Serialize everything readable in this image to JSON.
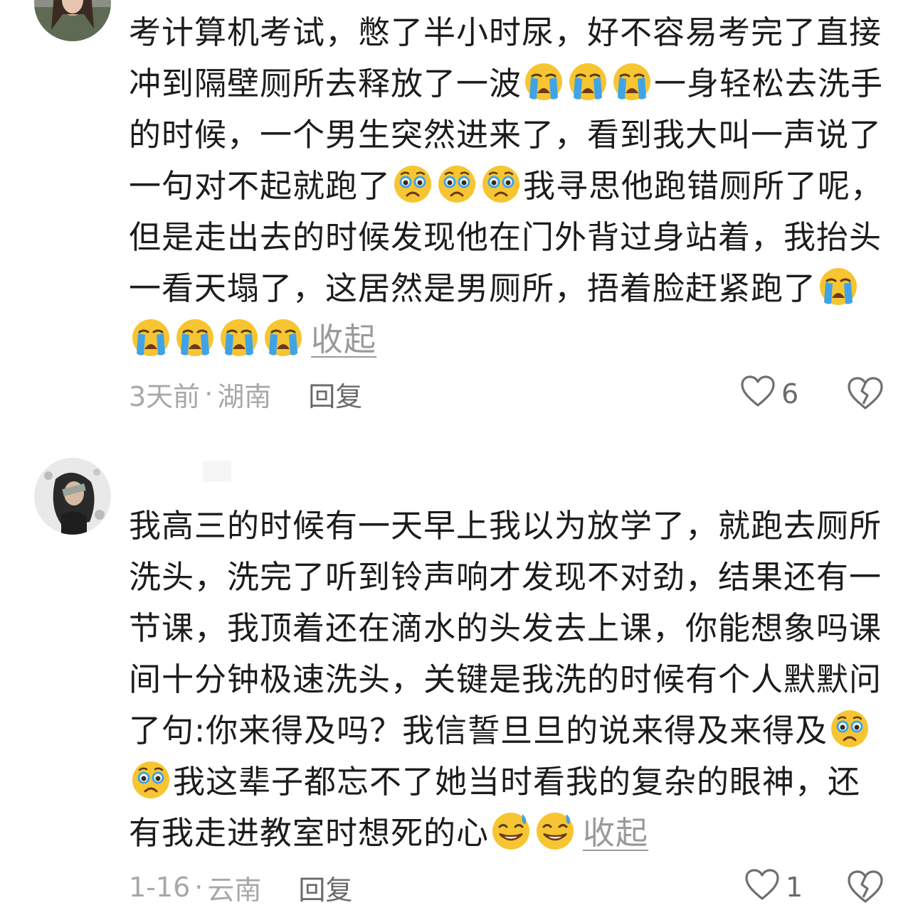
{
  "comments": [
    {
      "avatar_icon": "user-avatar-photo",
      "segments": [
        {
          "t": "考计算机考试，憋了半小时尿，好不容易考完了直接冲到隔壁厕所去释放了一波"
        },
        {
          "emoji": "loudly-crying-face"
        },
        {
          "emoji": "loudly-crying-face"
        },
        {
          "emoji": "loudly-crying-face"
        },
        {
          "t": "一身轻松去洗手的时候，一个男生突然进来了，看到我大叫一声说了一句对不起就跑了"
        },
        {
          "emoji": "face-holding-back-tears"
        },
        {
          "emoji": "face-holding-back-tears"
        },
        {
          "emoji": "face-holding-back-tears"
        },
        {
          "t": "我寻思他跑错厕所了呢，但是走出去的时候发现他在门外背过身站着，我抬头一看天塌了，这居然是男厕所，捂着脸赶紧跑了"
        },
        {
          "emoji": "loudly-crying-face"
        },
        {
          "emoji": "loudly-crying-face"
        },
        {
          "emoji": "loudly-crying-face"
        },
        {
          "emoji": "loudly-crying-face"
        },
        {
          "emoji": "loudly-crying-face"
        }
      ],
      "collapse_label": "收起",
      "time": "3天前",
      "separator": "·",
      "location": "湖南",
      "reply_label": "回复",
      "like_count": "6"
    },
    {
      "avatar_icon": "user-avatar-photo",
      "segments": [
        {
          "t": "我高三的时候有一天早上我以为放学了，就跑去厕所洗头，洗完了听到铃声响才发现不对劲，结果还有一节课，我顶着还在滴水的头发去上课，你能想象吗课间十分钟极速洗头，关键是我洗的时候有个人默默问了句:你来得及吗？我信誓旦旦的说来得及来得及"
        },
        {
          "emoji": "face-holding-back-tears"
        },
        {
          "emoji": "face-holding-back-tears"
        },
        {
          "t": "我这辈子都忘不了她当时看我的复杂的眼神，还有我走进教室时想死的心"
        },
        {
          "emoji": "grinning-face-with-sweat"
        },
        {
          "emoji": "grinning-face-with-sweat"
        }
      ],
      "collapse_label": "收起",
      "time": "1-16",
      "separator": "·",
      "location": "云南",
      "reply_label": "回复",
      "like_count": "1"
    }
  ],
  "icons": {
    "like": "heart-outline-icon",
    "dislike": "broken-heart-outline-icon"
  },
  "colors": {
    "text": "#1c1c1c",
    "meta": "#a8a8a8",
    "reply": "#6a6a6a",
    "emoji_yellow": "#f7c531",
    "tears_blue": "#3fa3e8"
  }
}
